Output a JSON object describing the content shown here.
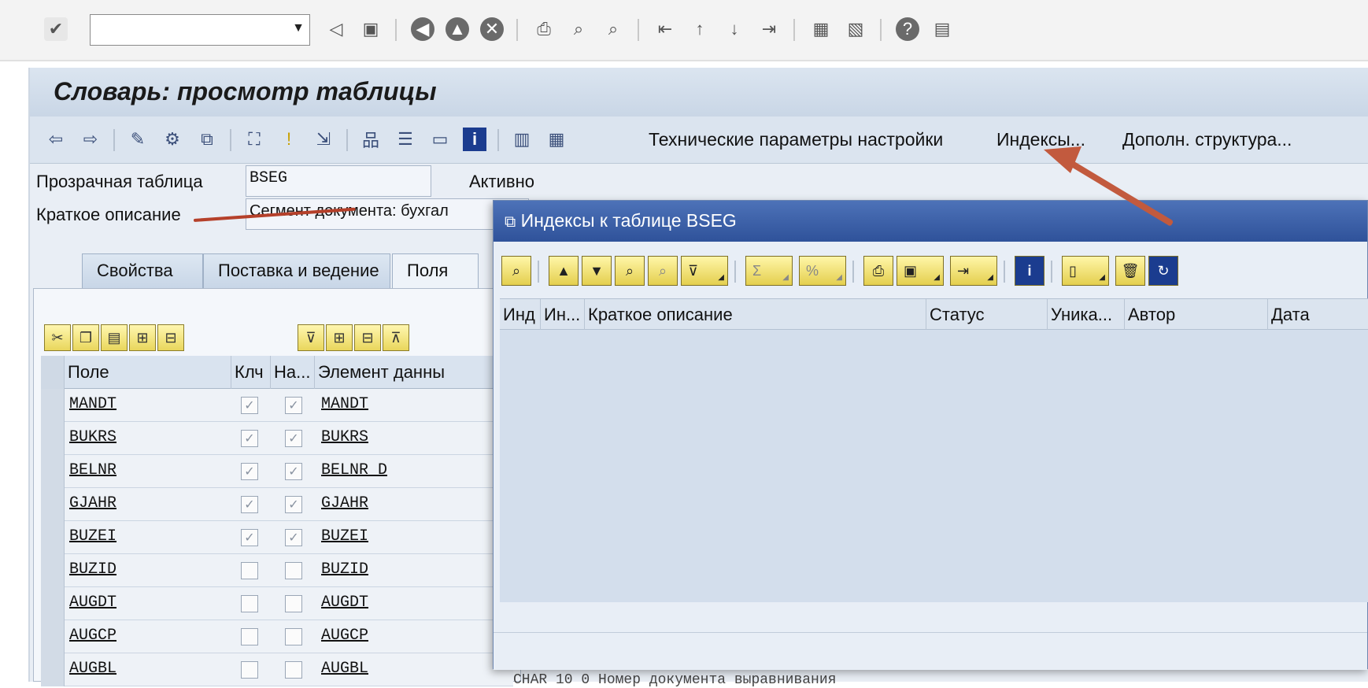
{
  "toolbar": {
    "command_field_value": "",
    "icons": [
      "check-icon",
      "save-icon",
      "back-icon",
      "exit-icon",
      "cancel-icon",
      "print-icon",
      "find-icon",
      "find-next-icon",
      "first-page-icon",
      "prev-page-icon",
      "next-page-icon",
      "last-page-icon",
      "new-session-icon",
      "shortcut-icon",
      "help-icon",
      "layout-icon"
    ]
  },
  "page": {
    "title": "Словарь: просмотр таблицы",
    "app_buttons": {
      "tech_settings": "Технические параметры настройки",
      "indexes": "Индексы...",
      "append_structure": "Дополн. структура..."
    },
    "transparent_table_label": "Прозрачная таблица",
    "transparent_table_value": "BSEG",
    "status_label": "Активно",
    "short_desc_label": "Краткое описание",
    "short_desc_value": "Сегмент документа: бухгал"
  },
  "tabs": [
    "Свойства",
    "Поставка и ведение",
    "Поля"
  ],
  "fields_grid": {
    "headers": [
      "Поле",
      "Клч",
      "На...",
      "Элемент данны"
    ],
    "rows": [
      {
        "field": "MANDT",
        "key": true,
        "init": true,
        "element": "MANDT"
      },
      {
        "field": "BUKRS",
        "key": true,
        "init": true,
        "element": "BUKRS"
      },
      {
        "field": "BELNR",
        "key": true,
        "init": true,
        "element": "BELNR_D"
      },
      {
        "field": "GJAHR",
        "key": true,
        "init": true,
        "element": "GJAHR"
      },
      {
        "field": "BUZEI",
        "key": true,
        "init": true,
        "element": "BUZEI"
      },
      {
        "field": "BUZID",
        "key": false,
        "init": false,
        "element": "BUZID"
      },
      {
        "field": "AUGDT",
        "key": false,
        "init": false,
        "element": "AUGDT"
      },
      {
        "field": "AUGCP",
        "key": false,
        "init": false,
        "element": "AUGCP"
      },
      {
        "field": "AUGBL",
        "key": false,
        "init": false,
        "element": "AUGBL"
      }
    ],
    "partial_last_row_text": "CHAR    10    0 Номер документа выравнивания"
  },
  "dialog": {
    "title": "Индексы к таблице BSEG",
    "headers": [
      "Инд",
      "Ин...",
      "Краткое описание",
      "Статус",
      "Уника...",
      "Автор",
      "Дата"
    ]
  },
  "colors": {
    "dialog_title_bg": "#2f529a",
    "annotation_red": "#c25a3e",
    "tool_button_yellow": "#e9d65c"
  }
}
